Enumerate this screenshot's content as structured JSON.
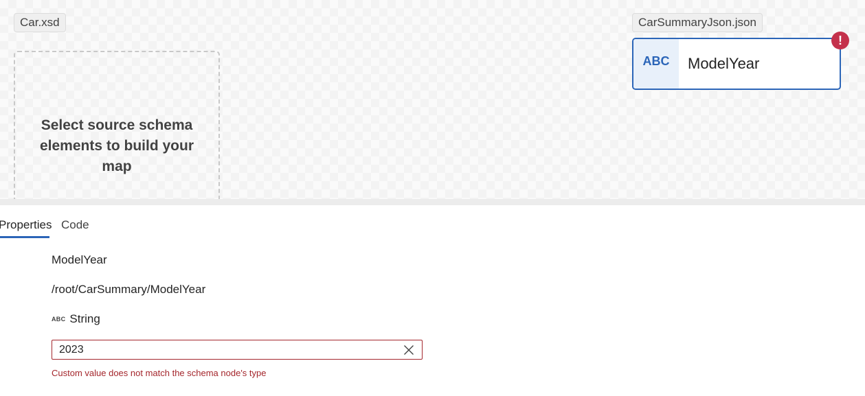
{
  "canvas": {
    "source_schema_name": "Car.xsd",
    "target_schema_name": "CarSummaryJson.json",
    "empty_source_message": "Select source schema elements to build your map",
    "target_node": {
      "type_label": "ABC",
      "name": "ModelYear",
      "error_badge": "!"
    }
  },
  "panel": {
    "tabs": [
      {
        "label": "Properties",
        "active": true
      },
      {
        "label": "Code",
        "active": false
      }
    ],
    "node_name": "ModelYear",
    "node_path": "/root/CarSummary/ModelYear",
    "type_icon": "ABC",
    "type_name": "String",
    "custom_value": "2023",
    "clear_icon": "dismiss-icon",
    "error_message": "Custom value does not match the schema node's type"
  },
  "colors": {
    "accent": "#2b65b8",
    "error": "#a4262c",
    "error_badge": "#c4314b"
  }
}
